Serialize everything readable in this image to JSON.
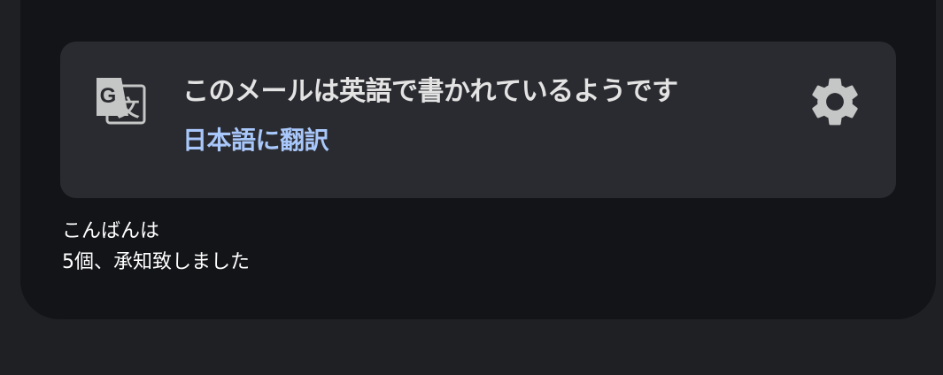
{
  "translate_banner": {
    "icon": "google-translate-icon",
    "title": "このメールは英語で書かれているようです",
    "translate_link": "日本語に翻訳",
    "settings_icon": "gear-icon"
  },
  "message": {
    "lines": [
      "こんばんは",
      "5個、承知致しました"
    ]
  },
  "colors": {
    "page_background": "#1f2023",
    "mail_background": "#131418",
    "banner_background": "#2a2b30",
    "title_text": "#e3e3e3",
    "link_text": "#a8c7fa",
    "icon": "#c4c7c5"
  }
}
